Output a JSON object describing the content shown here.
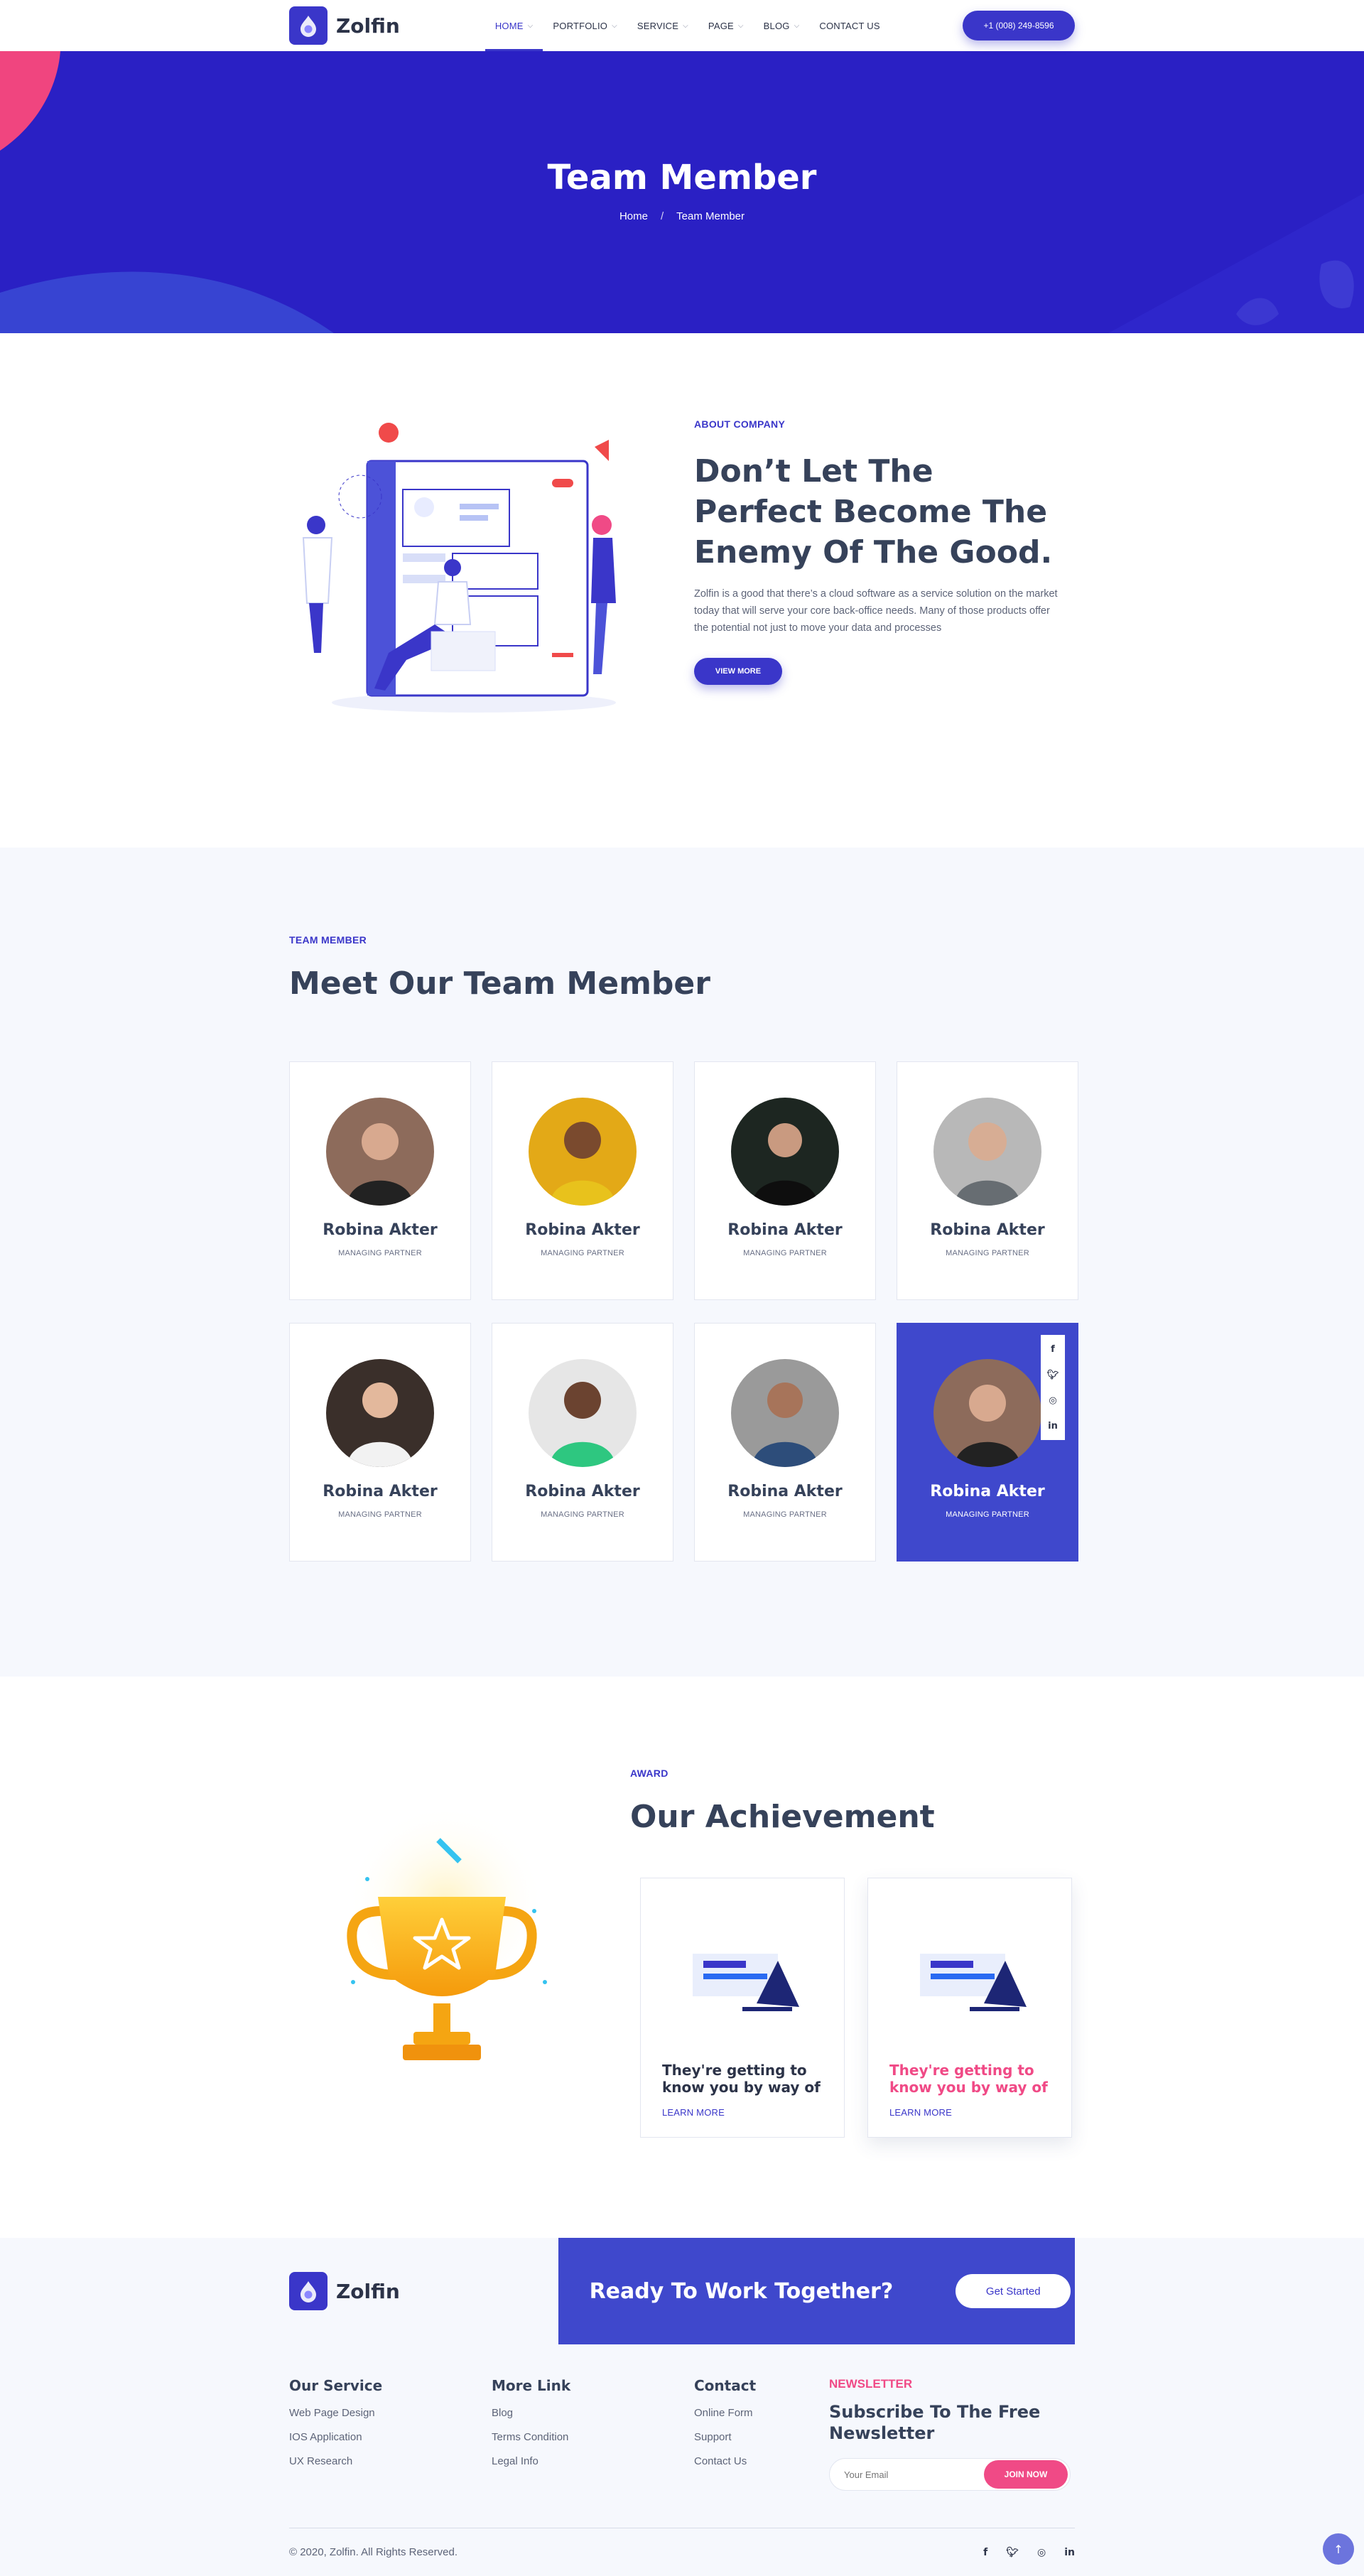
{
  "colors": {
    "primary": "#3a36c9",
    "hero": "#2a20c4",
    "featured_card": "#3f48cc",
    "accent_pink": "#f04a86",
    "text_dark": "#36425a",
    "section_bg": "#f6f8fd"
  },
  "header": {
    "logo_text": "Zolfin",
    "nav": [
      {
        "label": "HOME",
        "has_dropdown": true,
        "active": true
      },
      {
        "label": "PORTFOLIO",
        "has_dropdown": true
      },
      {
        "label": "SERVICE",
        "has_dropdown": true
      },
      {
        "label": "PAGE",
        "has_dropdown": true
      },
      {
        "label": "BLOG",
        "has_dropdown": true
      },
      {
        "label": "CONTACT US",
        "has_dropdown": false
      }
    ],
    "phone": "+1 (008) 249-8596"
  },
  "hero": {
    "title": "Team Member",
    "breadcrumb": {
      "home": "Home",
      "separator": "/",
      "current": "Team Member"
    }
  },
  "about": {
    "eyebrow": "ABOUT COMPANY",
    "title": "Don’t Let The Perfect Become The Enemy Of The Good.",
    "description": "Zolfin is a good that there’s a cloud software as a service solution on the market today that will serve your core back-office needs. Many of those products offer the potential not just to move your data and processes",
    "button": "VIEW MORE"
  },
  "team": {
    "eyebrow": "TEAM MEMBER",
    "title": "Meet Our Team Member",
    "members": [
      {
        "name": "Robina Akter",
        "role": "MANAGING PARTNER"
      },
      {
        "name": "Robina Akter",
        "role": "MANAGING PARTNER"
      },
      {
        "name": "Robina Akter",
        "role": "MANAGING PARTNER"
      },
      {
        "name": "Robina Akter",
        "role": "MANAGING PARTNER"
      },
      {
        "name": "Robina Akter",
        "role": "MANAGING PARTNER"
      },
      {
        "name": "Robina Akter",
        "role": "MANAGING PARTNER"
      },
      {
        "name": "Robina Akter",
        "role": "MANAGING PARTNER"
      },
      {
        "name": "Robina Akter",
        "role": "MANAGING PARTNER",
        "featured": true
      }
    ],
    "social_icons": [
      "facebook-icon",
      "twitter-icon",
      "instagram-icon",
      "linkedin-icon"
    ]
  },
  "achievement": {
    "eyebrow": "AWARD",
    "title": "Our Achievement",
    "cards": [
      {
        "title": "They're getting to know you by way of",
        "link": "LEARN MORE"
      },
      {
        "title": "They're getting to know you by way of",
        "link": "LEARN MORE"
      }
    ]
  },
  "footer": {
    "logo_text": "Zolfin",
    "cta_text": "Ready To Work Together?",
    "cta_button": "Get Started",
    "columns": [
      {
        "title": "Our Service",
        "items": [
          "Web Page Design",
          "IOS Application",
          "UX Research"
        ]
      },
      {
        "title": "More Link",
        "items": [
          "Blog",
          "Terms Condition",
          "Legal Info"
        ]
      },
      {
        "title": "Contact",
        "items": [
          "Online Form",
          "Support",
          "Contact Us"
        ]
      }
    ],
    "newsletter": {
      "eyebrow": "NEWSLETTER",
      "title": "Subscribe To The Free Newsletter",
      "placeholder": "Your Email",
      "button": "JOIN NOW"
    },
    "copyright": "© 2020, Zolfin. All Rights Reserved.",
    "social": [
      "f",
      "t",
      "ig",
      "in"
    ]
  }
}
